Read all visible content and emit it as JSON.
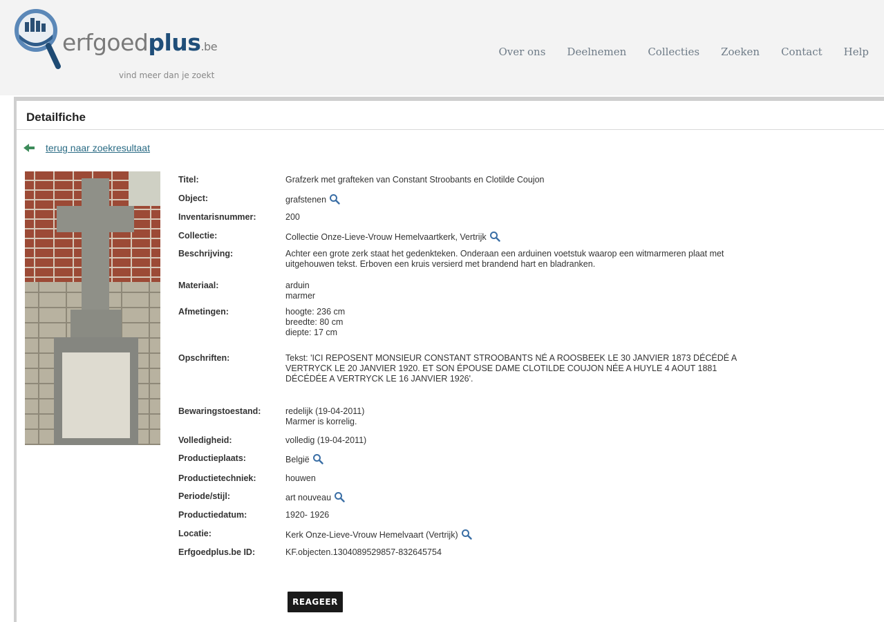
{
  "header": {
    "logo": {
      "prefix": "erfgoed",
      "bold": "plus",
      "suffix": ".be",
      "tagline": "vind meer dan je zoekt"
    },
    "nav": [
      "Over ons",
      "Deelnemen",
      "Collecties",
      "Zoeken",
      "Contact",
      "Help"
    ]
  },
  "page": {
    "section_title": "Detailfiche",
    "back_link": "terug naar zoekresultaat",
    "button_label": "REAGEER"
  },
  "fields": [
    {
      "label": "Titel:",
      "lines": [
        "Grafzerk met grafteken van Constant Stroobants en Clotilde Coujon"
      ],
      "search": false
    },
    {
      "label": "Object:",
      "lines": [
        "grafstenen"
      ],
      "search": true
    },
    {
      "label": "Inventarisnummer:",
      "lines": [
        "200"
      ],
      "search": false
    },
    {
      "label": "Collectie:",
      "lines": [
        "Collectie Onze-Lieve-Vrouw Hemelvaartkerk, Vertrijk"
      ],
      "search": true
    },
    {
      "label": "Beschrijving:",
      "lines": [
        "Achter een grote zerk staat het gedenkteken. Onderaan een arduinen voetstuk waarop een witmarmeren plaat met",
        "uitgehouwen tekst. Erboven een kruis versierd met brandend hart en bladranken."
      ],
      "search": false
    },
    {
      "label": "Materiaal:",
      "lines": [
        "arduin",
        "marmer"
      ],
      "search": false
    },
    {
      "label": "Afmetingen:",
      "lines": [
        "hoogte: 236 cm",
        "breedte: 80 cm",
        "diepte: 17 cm"
      ],
      "search": false
    },
    {
      "label": "Opschriften:",
      "lines": [
        "Tekst: 'ICI REPOSENT MONSIEUR CONSTANT STROOBANTS NÉ A ROOSBEEK LE 30 JANVIER 1873 DÉCÉDÉ A",
        "VERTRYCK LE 20 JANVIER 1920. ET SON ÉPOUSE DAME CLOTILDE COUJON NÉE A HUYLE 4 AOUT 1881",
        "DÉCÉDÉE A VERTRYCK LE 16 JANVIER 1926'."
      ],
      "search": false
    },
    {
      "label": "Bewaringstoestand:",
      "lines": [
        "redelijk (19-04-2011)",
        "Marmer is korrelig."
      ],
      "search": false
    },
    {
      "label": "Volledigheid:",
      "lines": [
        "volledig (19-04-2011)"
      ],
      "search": false
    },
    {
      "label": "Productieplaats:",
      "lines": [
        "België"
      ],
      "search": true
    },
    {
      "label": "Productietechniek:",
      "lines": [
        "houwen"
      ],
      "search": false
    },
    {
      "label": "Periode/stijl:",
      "lines": [
        "art nouveau"
      ],
      "search": true
    },
    {
      "label": "Productiedatum:",
      "lines": [
        "1920- 1926"
      ],
      "search": false
    },
    {
      "label": "Locatie:",
      "lines": [
        "Kerk Onze-Lieve-Vrouw Hemelvaart (Vertrijk)"
      ],
      "search": true
    },
    {
      "label": "Erfgoedplus.be ID:",
      "lines": [
        "KF.objecten.1304089529857-832645754"
      ],
      "search": false
    }
  ]
}
